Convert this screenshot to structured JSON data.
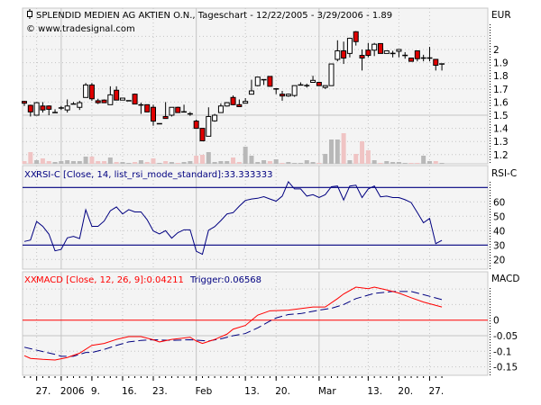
{
  "header": {
    "title": "SPLENDID MEDIEN AG AKTIEN O.N., Tageschart - 12/22/2005 - 3/29/2006 - 1.89",
    "copyright": "© www.tradesignal.com",
    "currency": "EUR"
  },
  "colors": {
    "up_candle": "#ffffff",
    "down_candle": "#e00000",
    "volume_up": "#b8b8b8",
    "volume_down": "#f0c4c4",
    "rsi_line": "#000080",
    "macd_line": "#ff0000",
    "trigger_line": "#000080",
    "panel_bg": "#f4f4f4"
  },
  "rsi_panel": {
    "label": "RSI-C [Close, 14, list_rsi_mode_standard]:33.333333",
    "axis_title": "RSI-C"
  },
  "macd_panel": {
    "label": "MACD [Close, 12, 26, 9]:0.04211",
    "trigger_label": "Trigger:0.06568",
    "axis_title": "MACD"
  },
  "chart_data": [
    {
      "type": "candlestick",
      "title": "SPLENDID MEDIEN AG AKTIEN O.N., Tageschart - 12/22/2005 - 3/29/2006 - 1.89",
      "ylabel": "EUR",
      "ylim": [
        1.15,
        2.2
      ],
      "yticks": [
        "2",
        "1.9",
        "1.8",
        "1.7",
        "1.6",
        "1.5",
        "1.4",
        "1.3",
        "1.2"
      ],
      "grid": true,
      "columns": [
        "date",
        "open",
        "high",
        "low",
        "close",
        "volume"
      ],
      "candles": [
        [
          "2005-12-22",
          1.605,
          1.61,
          1.57,
          1.595,
          3
        ],
        [
          "2005-12-23",
          1.575,
          1.58,
          1.49,
          1.525,
          13
        ],
        [
          "2005-12-27",
          1.5,
          1.6,
          1.5,
          1.595,
          4
        ],
        [
          "2005-12-28",
          1.57,
          1.6,
          1.52,
          1.54,
          6
        ],
        [
          "2005-12-29",
          1.57,
          1.575,
          1.5,
          1.545,
          3
        ],
        [
          "2005-12-30",
          1.52,
          1.545,
          1.52,
          1.52,
          2
        ],
        [
          "2006-01-02",
          1.555,
          1.57,
          1.54,
          1.555,
          3
        ],
        [
          "2006-01-03",
          1.54,
          1.62,
          1.52,
          1.57,
          4
        ],
        [
          "2006-01-04",
          1.585,
          1.6,
          1.585,
          1.585,
          3
        ],
        [
          "2006-01-05",
          1.56,
          1.61,
          1.54,
          1.595,
          3
        ],
        [
          "2006-01-06",
          1.635,
          1.745,
          1.635,
          1.73,
          8
        ],
        [
          "2006-01-09",
          1.73,
          1.745,
          1.61,
          1.625,
          8
        ],
        [
          "2006-01-10",
          1.61,
          1.625,
          1.585,
          1.595,
          3
        ],
        [
          "2006-01-11",
          1.615,
          1.62,
          1.595,
          1.595,
          3
        ],
        [
          "2006-01-12",
          1.58,
          1.72,
          1.58,
          1.655,
          7
        ],
        [
          "2006-01-13",
          1.69,
          1.72,
          1.615,
          1.615,
          2
        ],
        [
          "2006-01-16",
          1.615,
          1.63,
          1.615,
          1.63,
          2
        ],
        [
          "2006-01-17",
          1.61,
          1.61,
          1.61,
          1.61,
          1
        ],
        [
          "2006-01-18",
          1.66,
          1.665,
          1.585,
          1.585,
          2
        ],
        [
          "2006-01-19",
          1.578,
          1.595,
          1.51,
          1.578,
          4
        ],
        [
          "2006-01-20",
          1.58,
          1.58,
          1.525,
          1.525,
          2
        ],
        [
          "2006-01-23",
          1.56,
          1.58,
          1.42,
          1.455,
          6
        ],
        [
          "2006-01-24",
          1.435,
          1.435,
          1.435,
          1.435,
          1
        ],
        [
          "2006-01-25",
          1.49,
          1.6,
          1.475,
          1.475,
          3
        ],
        [
          "2006-01-26",
          1.5,
          1.56,
          1.49,
          1.56,
          2
        ],
        [
          "2006-01-27",
          1.56,
          1.565,
          1.52,
          1.52,
          1
        ],
        [
          "2006-01-30",
          1.525,
          1.58,
          1.525,
          1.525,
          2
        ],
        [
          "2006-01-31",
          1.51,
          1.525,
          1.495,
          1.51,
          3
        ],
        [
          "2006-02-01",
          1.455,
          1.465,
          1.4,
          1.4,
          9
        ],
        [
          "2006-02-02",
          1.4,
          1.4,
          1.305,
          1.305,
          10
        ],
        [
          "2006-02-03",
          1.34,
          1.56,
          1.34,
          1.49,
          13
        ],
        [
          "2006-02-06",
          1.457,
          1.51,
          1.45,
          1.5,
          2
        ],
        [
          "2006-02-07",
          1.52,
          1.59,
          1.52,
          1.57,
          3
        ],
        [
          "2006-02-08",
          1.57,
          1.6,
          1.565,
          1.595,
          3
        ],
        [
          "2006-02-09",
          1.635,
          1.65,
          1.575,
          1.58,
          7
        ],
        [
          "2006-02-10",
          1.58,
          1.62,
          1.565,
          1.565,
          2
        ],
        [
          "2006-02-13",
          1.595,
          1.63,
          1.59,
          1.605,
          19
        ],
        [
          "2006-02-14",
          1.66,
          1.77,
          1.66,
          1.685,
          9
        ],
        [
          "2006-02-15",
          1.725,
          1.79,
          1.72,
          1.79,
          2
        ],
        [
          "2006-02-16",
          1.77,
          1.77,
          1.73,
          1.77,
          4
        ],
        [
          "2006-02-17",
          1.795,
          1.795,
          1.72,
          1.72,
          3
        ],
        [
          "2006-02-20",
          1.7,
          1.7,
          1.66,
          1.7,
          5
        ],
        [
          "2006-02-21",
          1.66,
          1.685,
          1.61,
          1.65,
          1
        ],
        [
          "2006-02-22",
          1.65,
          1.665,
          1.64,
          1.66,
          2
        ],
        [
          "2006-02-23",
          1.65,
          1.725,
          1.64,
          1.725,
          1
        ],
        [
          "2006-02-24",
          1.73,
          1.75,
          1.73,
          1.73,
          1
        ],
        [
          "2006-02-27",
          1.725,
          1.74,
          1.71,
          1.725,
          4
        ],
        [
          "2006-02-28",
          1.75,
          1.8,
          1.75,
          1.765,
          2
        ],
        [
          "2006-03-01",
          1.75,
          1.75,
          1.725,
          1.725,
          1
        ],
        [
          "2006-03-02",
          1.715,
          1.725,
          1.7,
          1.725,
          11
        ],
        [
          "2006-03-03",
          1.725,
          1.89,
          1.725,
          1.89,
          27
        ],
        [
          "2006-03-06",
          1.925,
          2.07,
          1.91,
          1.99,
          27
        ],
        [
          "2006-03-07",
          1.99,
          2.06,
          1.89,
          1.935,
          34
        ],
        [
          "2006-03-08",
          1.97,
          2.09,
          1.94,
          2.085,
          4
        ],
        [
          "2006-03-09",
          2.135,
          2.14,
          2.03,
          2.06,
          11
        ],
        [
          "2006-03-10",
          1.955,
          2.0,
          1.84,
          1.935,
          25
        ],
        [
          "2006-03-13",
          1.995,
          2.05,
          1.94,
          1.955,
          15
        ],
        [
          "2006-03-14",
          1.995,
          2.05,
          1.95,
          2.04,
          4
        ],
        [
          "2006-03-15",
          2.045,
          2.045,
          1.97,
          1.97,
          1
        ],
        [
          "2006-03-16",
          1.97,
          1.99,
          1.97,
          1.99,
          3
        ],
        [
          "2006-03-17",
          1.97,
          1.99,
          1.94,
          1.97,
          2
        ],
        [
          "2006-03-20",
          1.99,
          2.0,
          1.94,
          2.0,
          2
        ],
        [
          "2006-03-21",
          1.955,
          1.98,
          1.93,
          1.955,
          1
        ],
        [
          "2006-03-22",
          1.935,
          1.935,
          1.91,
          1.91,
          1
        ],
        [
          "2006-03-23",
          1.99,
          1.99,
          1.91,
          1.93,
          1
        ],
        [
          "2006-03-24",
          1.935,
          1.96,
          1.91,
          1.935,
          9
        ],
        [
          "2006-03-27",
          1.935,
          2.02,
          1.91,
          1.935,
          3
        ],
        [
          "2006-03-28",
          1.925,
          1.925,
          1.84,
          1.88,
          3
        ],
        [
          "2006-03-29",
          1.89,
          1.89,
          1.84,
          1.89,
          1
        ]
      ],
      "xticks": [
        {
          "date": "2005-12-27",
          "label": "27."
        },
        {
          "date": "2006-01-02",
          "label": "2006",
          "major": true
        },
        {
          "date": "2006-01-09",
          "label": "9."
        },
        {
          "date": "2006-01-16",
          "label": "16."
        },
        {
          "date": "2006-01-23",
          "label": "23."
        },
        {
          "date": "2006-02-01",
          "label": "Feb",
          "major": true
        },
        {
          "date": "2006-02-13",
          "label": "13."
        },
        {
          "date": "2006-02-20",
          "label": "20."
        },
        {
          "date": "2006-03-01",
          "label": "Mar",
          "major": true
        },
        {
          "date": "2006-03-13",
          "label": "13."
        },
        {
          "date": "2006-03-20",
          "label": "20."
        },
        {
          "date": "2006-03-27",
          "label": "27."
        }
      ]
    },
    {
      "type": "line",
      "title": "RSI-C [Close, 14, list_rsi_mode_standard]:33.333333",
      "ylabel": "RSI-C",
      "ylim": [
        14,
        80
      ],
      "yticks": [
        "60",
        "50",
        "40",
        "30",
        "20"
      ],
      "reference_lines": [
        70,
        30
      ],
      "series": [
        {
          "name": "RSI-C",
          "values": [
            32.5,
            33.5,
            46.4,
            43,
            37.6,
            26,
            27,
            35,
            36,
            34.5,
            54.5,
            43,
            43,
            46.7,
            53.8,
            56.5,
            51.6,
            54.6,
            53,
            53,
            47.6,
            39.8,
            37.7,
            40,
            34.8,
            38.6,
            40.6,
            40.6,
            25.7,
            23.6,
            40.3,
            42.8,
            47,
            51.6,
            52.5,
            57,
            61,
            62,
            62.5,
            63.6,
            62,
            60.5,
            64,
            74,
            69,
            69,
            64,
            65,
            63,
            65,
            70.5,
            71,
            61.3,
            71,
            71.6,
            63,
            69,
            71,
            63.5,
            64,
            63,
            63,
            61.5,
            59.5,
            52.6,
            45.5,
            48.5,
            31,
            33.3
          ]
        }
      ]
    },
    {
      "type": "line",
      "title": "MACD [Close, 12, 26, 9]:0.04211",
      "ylabel": "MACD",
      "ylim": [
        -0.18,
        0.15
      ],
      "yticks": [
        "0",
        "-0.05",
        "-0.1",
        "-0.15"
      ],
      "reference_lines": [
        0
      ],
      "series": [
        {
          "name": "MACD",
          "points": [
            [
              "2005-12-22",
              -0.114
            ],
            [
              "2005-12-23",
              -0.123
            ],
            [
              "2005-12-28",
              -0.126
            ],
            [
              "2005-12-30",
              -0.128
            ],
            [
              "2006-01-03",
              -0.12
            ],
            [
              "2006-01-05",
              -0.106
            ],
            [
              "2006-01-09",
              -0.081
            ],
            [
              "2006-01-11",
              -0.075
            ],
            [
              "2006-01-13",
              -0.062
            ],
            [
              "2006-01-17",
              -0.053
            ],
            [
              "2006-01-19",
              -0.053
            ],
            [
              "2006-01-23",
              -0.063
            ],
            [
              "2006-01-24",
              -0.07
            ],
            [
              "2006-01-26",
              -0.062
            ],
            [
              "2006-01-31",
              -0.055
            ],
            [
              "2006-02-01",
              -0.067
            ],
            [
              "2006-02-02",
              -0.075
            ],
            [
              "2006-02-06",
              -0.062
            ],
            [
              "2006-02-08",
              -0.045
            ],
            [
              "2006-02-09",
              -0.029
            ],
            [
              "2006-02-13",
              -0.017
            ],
            [
              "2006-02-15",
              0.016
            ],
            [
              "2006-02-17",
              0.03
            ],
            [
              "2006-02-22",
              0.032
            ],
            [
              "2006-02-24",
              0.037
            ],
            [
              "2006-02-28",
              0.042
            ],
            [
              "2006-03-02",
              0.042
            ],
            [
              "2006-03-06",
              0.069
            ],
            [
              "2006-03-07",
              0.084
            ],
            [
              "2006-03-09",
              0.106
            ],
            [
              "2006-03-13",
              0.101
            ],
            [
              "2006-03-14",
              0.106
            ],
            [
              "2006-03-16",
              0.097
            ],
            [
              "2006-03-20",
              0.087
            ],
            [
              "2006-03-22",
              0.072
            ],
            [
              "2006-03-24",
              0.058
            ],
            [
              "2006-03-29",
              0.042
            ]
          ]
        },
        {
          "name": "Trigger",
          "points": [
            [
              "2005-12-22",
              -0.087
            ],
            [
              "2005-12-28",
              -0.101
            ],
            [
              "2005-12-30",
              -0.11
            ],
            [
              "2006-01-02",
              -0.116
            ],
            [
              "2006-01-04",
              -0.116
            ],
            [
              "2006-01-06",
              -0.104
            ],
            [
              "2006-01-09",
              -0.104
            ],
            [
              "2006-01-11",
              -0.094
            ],
            [
              "2006-01-13",
              -0.081
            ],
            [
              "2006-01-17",
              -0.07
            ],
            [
              "2006-01-19",
              -0.065
            ],
            [
              "2006-01-23",
              -0.063
            ],
            [
              "2006-01-26",
              -0.065
            ],
            [
              "2006-01-31",
              -0.063
            ],
            [
              "2006-02-03",
              -0.067
            ],
            [
              "2006-02-07",
              -0.06
            ],
            [
              "2006-02-09",
              -0.05
            ],
            [
              "2006-02-13",
              -0.043
            ],
            [
              "2006-02-15",
              -0.025
            ],
            [
              "2006-02-17",
              -0.003
            ],
            [
              "2006-02-20",
              0.007
            ],
            [
              "2006-02-22",
              0.018
            ],
            [
              "2006-02-24",
              0.021
            ],
            [
              "2006-03-01",
              0.032
            ],
            [
              "2006-03-03",
              0.038
            ],
            [
              "2006-03-07",
              0.05
            ],
            [
              "2006-03-09",
              0.069
            ],
            [
              "2006-03-14",
              0.086
            ],
            [
              "2006-03-17",
              0.092
            ],
            [
              "2006-03-22",
              0.092
            ],
            [
              "2006-03-24",
              0.082
            ],
            [
              "2006-03-29",
              0.066
            ]
          ]
        }
      ]
    }
  ]
}
